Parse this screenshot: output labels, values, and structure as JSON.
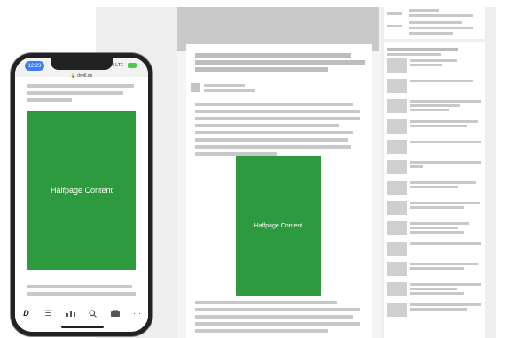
{
  "mobile": {
    "clock": "12:23",
    "signal": "LTE",
    "url": "dwdl.de",
    "content_label": "Halfpage Content",
    "nav": {
      "logo": "D",
      "list_icon": "list-icon",
      "chart_icon": "chart-icon",
      "search_icon": "search-icon",
      "briefcase_icon": "briefcase-icon",
      "more_icon": "more-icon"
    }
  },
  "desktop": {
    "content_label": "Halfpage Content"
  },
  "colors": {
    "ad_green": "#2e9a3f",
    "placeholder_grey": "#c8c8c8",
    "clock_blue": "#3d7ef0"
  }
}
